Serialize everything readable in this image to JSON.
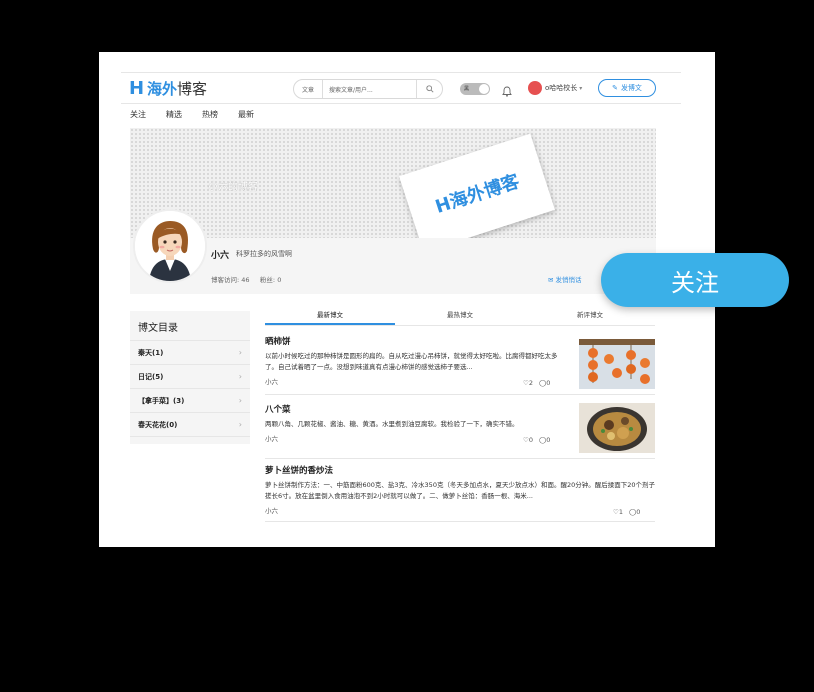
{
  "header": {
    "logo_letter": "H",
    "logo_blue": "海外",
    "logo_black": "博客",
    "search_category": "文章",
    "search_placeholder": "搜索文章/用户...",
    "toggle_label": "黑",
    "username": "o哈哈校长",
    "publish_label": "发博文"
  },
  "nav": [
    "关注",
    "精选",
    "热榜",
    "最新"
  ],
  "banner": {
    "blog_title": "小六的博客",
    "paper_logo": "H海外博客",
    "name": "小六",
    "signature": "科罗拉多的风雪啊",
    "visits_label": "博客访问:",
    "visits": "46",
    "fans_label": "粉丝:",
    "fans": "0",
    "message_label": "发悄悄话"
  },
  "sidebar": {
    "title": "博文目录",
    "items": [
      {
        "label": "秦天(1)"
      },
      {
        "label": "日记(5)"
      },
      {
        "label": "【拿手菜】(3)"
      },
      {
        "label": "春天花花(0)"
      }
    ]
  },
  "tabs": [
    "最新博文",
    "最热博文",
    "新评博文"
  ],
  "posts": [
    {
      "title": "晒柿饼",
      "desc": "以前小时候吃过的那种柿饼是圆形的扁的。自从吃过漫心吊柿饼，就觉得太好吃啦。比腐得都好吃太多了。自己试着晒了一点。没想到味道真有点漫心柿饼的感觉选柿子要选...",
      "author": "小六",
      "likes": "2",
      "comments": "0"
    },
    {
      "title": "八个菜",
      "desc": "两颗八角、几颗花椒、酱油、糖、黄酒。水里煮到油豆腐软。我检验了一下，确实不错。",
      "author": "小六",
      "likes": "0",
      "comments": "0"
    },
    {
      "title": "萝卜丝饼的香炒法",
      "desc": "萝卜丝饼制作方法：一、中筋面粉600克、盐3克、冷水350克（冬天多加点水，夏天少放点水）和面。醒20分钟。醒后揉面下20个剂子搓长6寸。放在盆里倒入食用油泡不到2小时就可以做了。二、做萝卜丝馅：香肠一根、海米...",
      "author": "小六",
      "likes": "1",
      "comments": "0"
    }
  ],
  "follow_label": "关注",
  "colors": {
    "accent": "#2f8fe0",
    "follow": "#3ab0e8"
  }
}
